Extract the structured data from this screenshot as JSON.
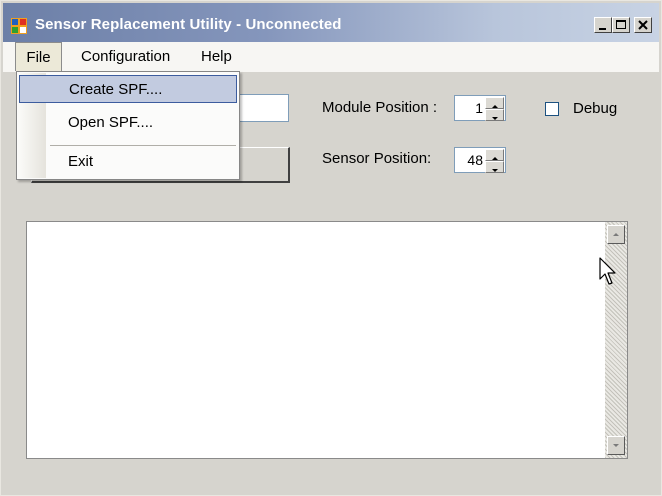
{
  "window": {
    "title": "Sensor Replacement Utility - Unconnected",
    "controls": [
      "minimize-icon",
      "maximize-icon",
      "close-icon"
    ]
  },
  "menubar": {
    "items": [
      {
        "label": "File"
      },
      {
        "label": "Configuration"
      },
      {
        "label": "Help"
      }
    ]
  },
  "file_menu": {
    "items": [
      {
        "label": "Create SPF...."
      },
      {
        "label": "Open SPF...."
      },
      {
        "label": "Exit"
      }
    ],
    "highlighted": "Create SPF...."
  },
  "form": {
    "module_position_label": "Module Position :",
    "module_position_value": "1",
    "sensor_position_label": "Sensor Position:",
    "sensor_position_value": "48",
    "debug_label": "Debug",
    "debug_checked": false
  },
  "colors": {
    "titlebar_start": "#6c7fa7",
    "titlebar_end": "#c8d3e4",
    "highlight": "#c2cbe0"
  }
}
